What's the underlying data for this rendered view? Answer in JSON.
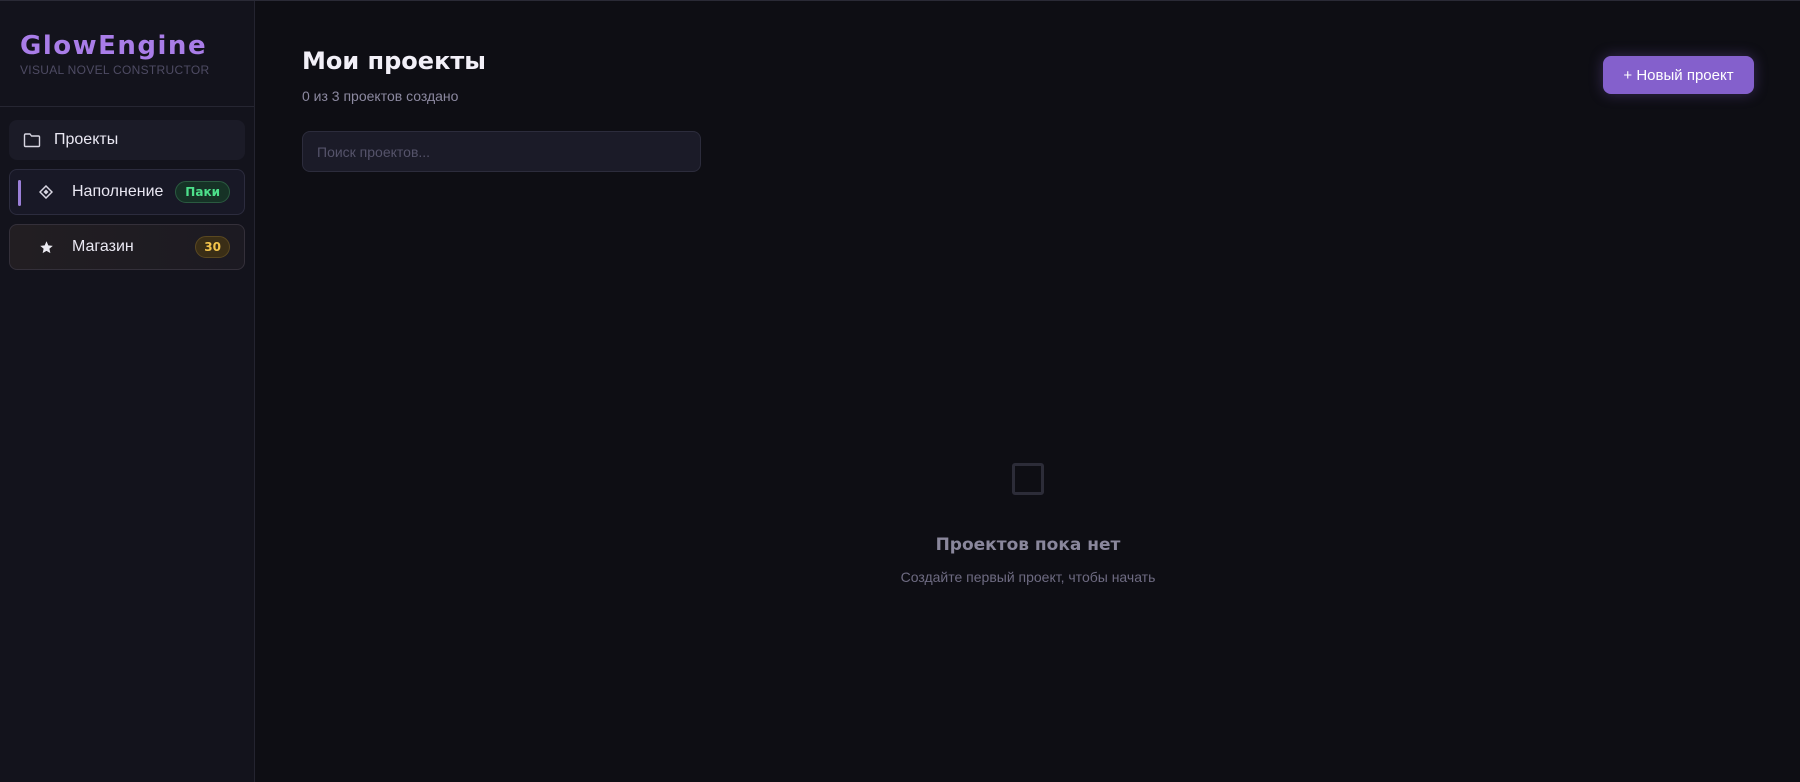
{
  "brand": {
    "title": "GlowEngine",
    "subtitle": "VISUAL NOVEL CONSTRUCTOR",
    "accent": "#a97de8"
  },
  "sidebar": {
    "items": [
      {
        "label": "Проекты",
        "icon": "folder-icon"
      },
      {
        "label": "Наполнение",
        "icon": "diamond-icon",
        "badge": "Паки",
        "badge_color": "#4de08b"
      },
      {
        "label": "Магазин",
        "icon": "star-icon",
        "badge": "30",
        "badge_color": "#f2c34b"
      }
    ]
  },
  "main": {
    "title": "Мои проекты",
    "subtitle": "0 из 3 проектов создано",
    "new_button": "+ Новый проект",
    "search_placeholder": "Поиск проектов...",
    "empty_title": "Проектов пока нет",
    "empty_subtitle": "Создайте первый проект, чтобы начать"
  },
  "colors": {
    "primary_button": "#8460cc",
    "background": "#0e0e14",
    "sidebar": "#13131c"
  }
}
